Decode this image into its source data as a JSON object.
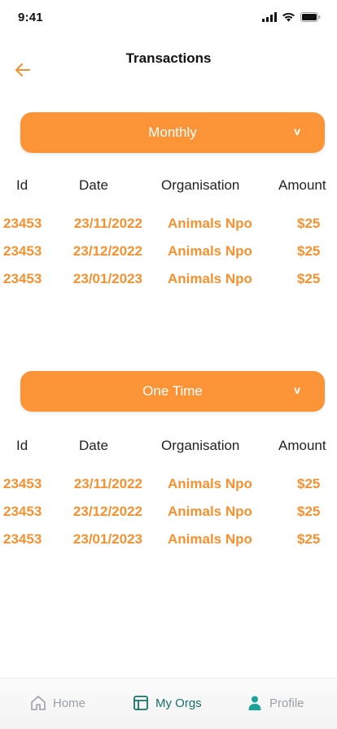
{
  "status": {
    "time": "9:41"
  },
  "header": {
    "title": "Transactions"
  },
  "colors": {
    "accent": "#FB9436",
    "text_accent": "#F7912F",
    "nav_active": "#16706a",
    "nav_inactive": "#9aa0a6"
  },
  "sections": [
    {
      "filter_label": "Monthly",
      "chevron": "v",
      "columns": [
        "Id",
        "Date",
        "Organisation",
        "Amount"
      ],
      "rows": [
        {
          "id": "23453",
          "date": "23/11/2022",
          "org": "Animals Npo",
          "amount": "$25"
        },
        {
          "id": "23453",
          "date": "23/12/2022",
          "org": "Animals Npo",
          "amount": "$25"
        },
        {
          "id": "23453",
          "date": "23/01/2023",
          "org": "Animals Npo",
          "amount": "$25"
        }
      ]
    },
    {
      "filter_label": "One Time",
      "chevron": "v",
      "columns": [
        "Id",
        "Date",
        "Organisation",
        "Amount"
      ],
      "rows": [
        {
          "id": "23453",
          "date": "23/11/2022",
          "org": "Animals Npo",
          "amount": "$25"
        },
        {
          "id": "23453",
          "date": "23/12/2022",
          "org": "Animals Npo",
          "amount": "$25"
        },
        {
          "id": "23453",
          "date": "23/01/2023",
          "org": "Animals Npo",
          "amount": "$25"
        }
      ]
    }
  ],
  "nav": {
    "items": [
      {
        "label": "Home",
        "icon": "home-icon",
        "active": false
      },
      {
        "label": "My Orgs",
        "icon": "layout-icon",
        "active": true
      },
      {
        "label": "Profile",
        "icon": "person-icon",
        "active": false
      }
    ]
  }
}
